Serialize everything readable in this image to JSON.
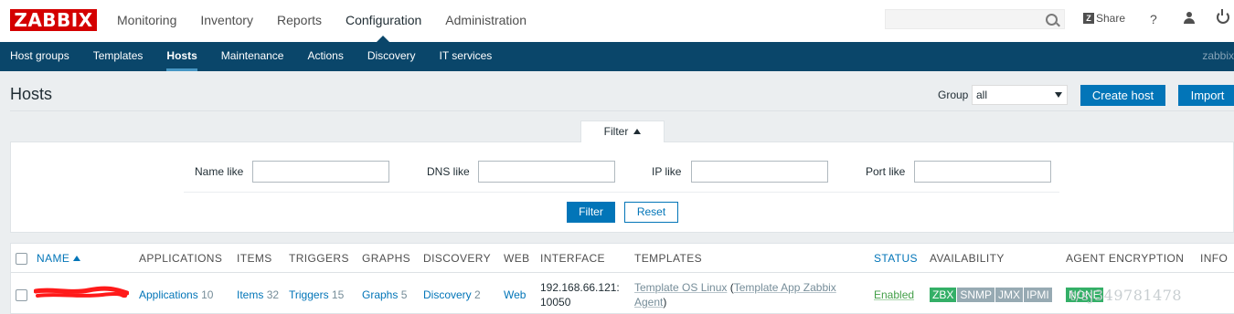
{
  "logo": "ZABBIX",
  "top_menu": [
    "Monitoring",
    "Inventory",
    "Reports",
    "Configuration",
    "Administration"
  ],
  "top_menu_active": "Configuration",
  "share_label": "Share",
  "help_label": "?",
  "sub_nav": [
    "Host groups",
    "Templates",
    "Hosts",
    "Maintenance",
    "Actions",
    "Discovery",
    "IT services"
  ],
  "sub_nav_active": "Hosts",
  "server_name": "zabbix",
  "page_title": "Hosts",
  "group_label": "Group",
  "group_value": "all",
  "create_host_label": "Create host",
  "import_label": "Import",
  "filter": {
    "tab_label": "Filter",
    "name_like_label": "Name like",
    "dns_like_label": "DNS like",
    "ip_like_label": "IP like",
    "port_like_label": "Port like",
    "name_like_value": "",
    "dns_like_value": "",
    "ip_like_value": "",
    "port_like_value": "",
    "filter_button": "Filter",
    "reset_button": "Reset"
  },
  "table": {
    "headers": {
      "name": "NAME",
      "applications": "APPLICATIONS",
      "items": "ITEMS",
      "triggers": "TRIGGERS",
      "graphs": "GRAPHS",
      "discovery": "DISCOVERY",
      "web": "WEB",
      "interface": "INTERFACE",
      "templates": "TEMPLATES",
      "status": "STATUS",
      "availability": "AVAILABILITY",
      "agent_encryption": "AGENT ENCRYPTION",
      "info": "INFO"
    },
    "rows": [
      {
        "applications_label": "Applications",
        "applications_count": "10",
        "items_label": "Items",
        "items_count": "32",
        "triggers_label": "Triggers",
        "triggers_count": "15",
        "graphs_label": "Graphs",
        "graphs_count": "5",
        "discovery_label": "Discovery",
        "discovery_count": "2",
        "web_label": "Web",
        "interface_line1": "192.168.66.121:",
        "interface_line2": "10050",
        "template_main": "Template OS Linux",
        "template_open": " (",
        "template_sub_line1": "Template App Zabbix",
        "template_sub_line2": "Agent",
        "template_close": ")",
        "status": "Enabled",
        "availability": [
          "ZBX",
          "SNMP",
          "JMX",
          "IPMI"
        ],
        "encryption": "NONE"
      }
    ]
  },
  "watermark": "t/sj349781478",
  "colors": {
    "logo_red": "#d40000",
    "nav_blue": "#0a466a",
    "link_blue": "#0275b8",
    "status_green": "#429e47",
    "zbx_green": "#34af67",
    "availability_gray": "#97aab3"
  }
}
